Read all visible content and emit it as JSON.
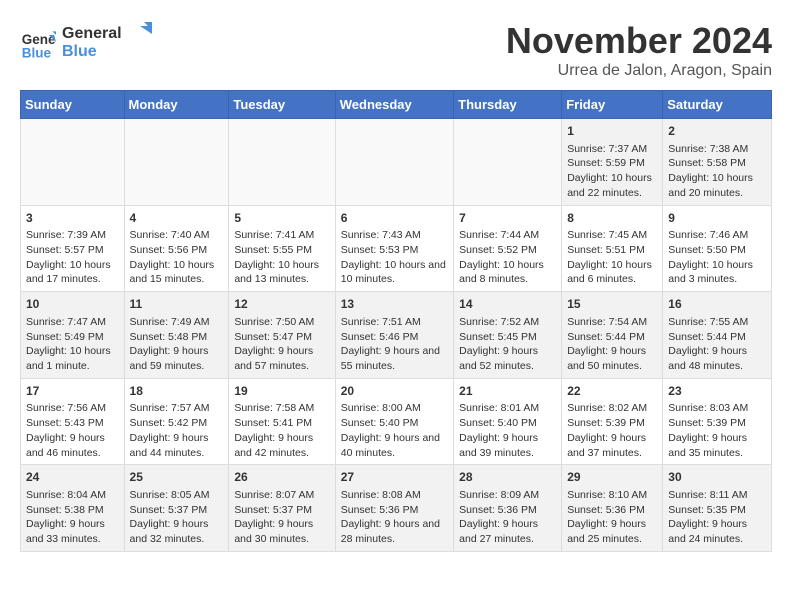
{
  "logo": {
    "line1": "General",
    "line2": "Blue"
  },
  "title": "November 2024",
  "location": "Urrea de Jalon, Aragon, Spain",
  "weekdays": [
    "Sunday",
    "Monday",
    "Tuesday",
    "Wednesday",
    "Thursday",
    "Friday",
    "Saturday"
  ],
  "weeks": [
    [
      {
        "day": "",
        "content": ""
      },
      {
        "day": "",
        "content": ""
      },
      {
        "day": "",
        "content": ""
      },
      {
        "day": "",
        "content": ""
      },
      {
        "day": "",
        "content": ""
      },
      {
        "day": "1",
        "content": "Sunrise: 7:37 AM\nSunset: 5:59 PM\nDaylight: 10 hours and 22 minutes."
      },
      {
        "day": "2",
        "content": "Sunrise: 7:38 AM\nSunset: 5:58 PM\nDaylight: 10 hours and 20 minutes."
      }
    ],
    [
      {
        "day": "3",
        "content": "Sunrise: 7:39 AM\nSunset: 5:57 PM\nDaylight: 10 hours and 17 minutes."
      },
      {
        "day": "4",
        "content": "Sunrise: 7:40 AM\nSunset: 5:56 PM\nDaylight: 10 hours and 15 minutes."
      },
      {
        "day": "5",
        "content": "Sunrise: 7:41 AM\nSunset: 5:55 PM\nDaylight: 10 hours and 13 minutes."
      },
      {
        "day": "6",
        "content": "Sunrise: 7:43 AM\nSunset: 5:53 PM\nDaylight: 10 hours and 10 minutes."
      },
      {
        "day": "7",
        "content": "Sunrise: 7:44 AM\nSunset: 5:52 PM\nDaylight: 10 hours and 8 minutes."
      },
      {
        "day": "8",
        "content": "Sunrise: 7:45 AM\nSunset: 5:51 PM\nDaylight: 10 hours and 6 minutes."
      },
      {
        "day": "9",
        "content": "Sunrise: 7:46 AM\nSunset: 5:50 PM\nDaylight: 10 hours and 3 minutes."
      }
    ],
    [
      {
        "day": "10",
        "content": "Sunrise: 7:47 AM\nSunset: 5:49 PM\nDaylight: 10 hours and 1 minute."
      },
      {
        "day": "11",
        "content": "Sunrise: 7:49 AM\nSunset: 5:48 PM\nDaylight: 9 hours and 59 minutes."
      },
      {
        "day": "12",
        "content": "Sunrise: 7:50 AM\nSunset: 5:47 PM\nDaylight: 9 hours and 57 minutes."
      },
      {
        "day": "13",
        "content": "Sunrise: 7:51 AM\nSunset: 5:46 PM\nDaylight: 9 hours and 55 minutes."
      },
      {
        "day": "14",
        "content": "Sunrise: 7:52 AM\nSunset: 5:45 PM\nDaylight: 9 hours and 52 minutes."
      },
      {
        "day": "15",
        "content": "Sunrise: 7:54 AM\nSunset: 5:44 PM\nDaylight: 9 hours and 50 minutes."
      },
      {
        "day": "16",
        "content": "Sunrise: 7:55 AM\nSunset: 5:44 PM\nDaylight: 9 hours and 48 minutes."
      }
    ],
    [
      {
        "day": "17",
        "content": "Sunrise: 7:56 AM\nSunset: 5:43 PM\nDaylight: 9 hours and 46 minutes."
      },
      {
        "day": "18",
        "content": "Sunrise: 7:57 AM\nSunset: 5:42 PM\nDaylight: 9 hours and 44 minutes."
      },
      {
        "day": "19",
        "content": "Sunrise: 7:58 AM\nSunset: 5:41 PM\nDaylight: 9 hours and 42 minutes."
      },
      {
        "day": "20",
        "content": "Sunrise: 8:00 AM\nSunset: 5:40 PM\nDaylight: 9 hours and 40 minutes."
      },
      {
        "day": "21",
        "content": "Sunrise: 8:01 AM\nSunset: 5:40 PM\nDaylight: 9 hours and 39 minutes."
      },
      {
        "day": "22",
        "content": "Sunrise: 8:02 AM\nSunset: 5:39 PM\nDaylight: 9 hours and 37 minutes."
      },
      {
        "day": "23",
        "content": "Sunrise: 8:03 AM\nSunset: 5:39 PM\nDaylight: 9 hours and 35 minutes."
      }
    ],
    [
      {
        "day": "24",
        "content": "Sunrise: 8:04 AM\nSunset: 5:38 PM\nDaylight: 9 hours and 33 minutes."
      },
      {
        "day": "25",
        "content": "Sunrise: 8:05 AM\nSunset: 5:37 PM\nDaylight: 9 hours and 32 minutes."
      },
      {
        "day": "26",
        "content": "Sunrise: 8:07 AM\nSunset: 5:37 PM\nDaylight: 9 hours and 30 minutes."
      },
      {
        "day": "27",
        "content": "Sunrise: 8:08 AM\nSunset: 5:36 PM\nDaylight: 9 hours and 28 minutes."
      },
      {
        "day": "28",
        "content": "Sunrise: 8:09 AM\nSunset: 5:36 PM\nDaylight: 9 hours and 27 minutes."
      },
      {
        "day": "29",
        "content": "Sunrise: 8:10 AM\nSunset: 5:36 PM\nDaylight: 9 hours and 25 minutes."
      },
      {
        "day": "30",
        "content": "Sunrise: 8:11 AM\nSunset: 5:35 PM\nDaylight: 9 hours and 24 minutes."
      }
    ]
  ]
}
